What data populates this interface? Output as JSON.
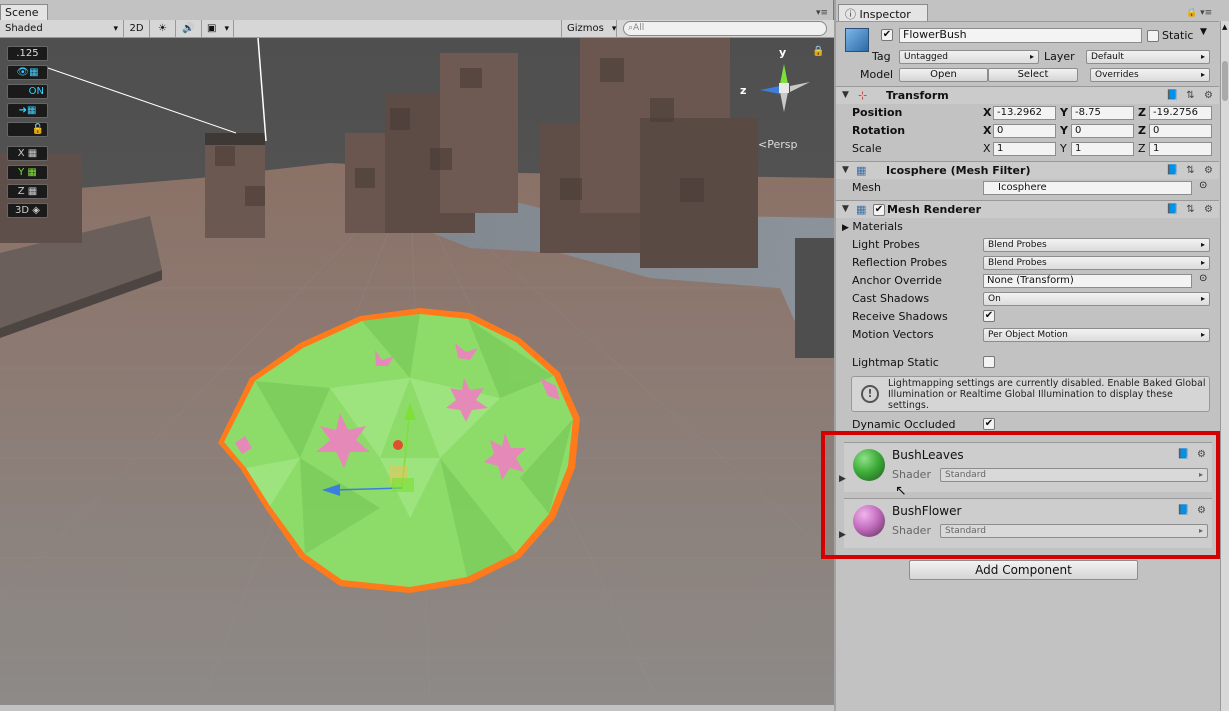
{
  "scene": {
    "tab_label": "Scene",
    "shading_mode": "Shaded",
    "btn_2d": "2D",
    "gizmos_label": "Gizmos",
    "search_placeholder": "All",
    "persp_label": "Persp",
    "gizmo_axes": {
      "y": "y",
      "z": "z"
    },
    "snap_widget": {
      "value": ".125",
      "on_label": "ON",
      "x": "X",
      "y": "Y",
      "z": "Z",
      "three_d": "3D"
    }
  },
  "inspector": {
    "tab_label": "Inspector",
    "object_name": "FlowerBush",
    "static_label": "Static",
    "tag_label": "Tag",
    "tag_value": "Untagged",
    "layer_label": "Layer",
    "layer_value": "Default",
    "model_label": "Model",
    "open_button": "Open",
    "select_button": "Select",
    "overrides_button": "Overrides",
    "transform": {
      "title": "Transform",
      "position_label": "Position",
      "rotation_label": "Rotation",
      "scale_label": "Scale",
      "axis_x": "X",
      "axis_y": "Y",
      "axis_z": "Z",
      "position": {
        "x": "-13.2962",
        "y": "-8.75",
        "z": "-19.2756"
      },
      "rotation": {
        "x": "0",
        "y": "0",
        "z": "0"
      },
      "scale": {
        "x": "1",
        "y": "1",
        "z": "1"
      }
    },
    "mesh_filter": {
      "title": "Icosphere (Mesh Filter)",
      "mesh_label": "Mesh",
      "mesh_value": "Icosphere"
    },
    "mesh_renderer": {
      "title": "Mesh Renderer",
      "materials_label": "Materials",
      "light_probes_label": "Light Probes",
      "light_probes_value": "Blend Probes",
      "reflection_probes_label": "Reflection Probes",
      "reflection_probes_value": "Blend Probes",
      "anchor_override_label": "Anchor Override",
      "anchor_override_value": "None (Transform)",
      "cast_shadows_label": "Cast Shadows",
      "cast_shadows_value": "On",
      "receive_shadows_label": "Receive Shadows",
      "motion_vectors_label": "Motion Vectors",
      "motion_vectors_value": "Per Object Motion",
      "lightmap_static_label": "Lightmap Static",
      "info_text": "Lightmapping settings are currently disabled. Enable Baked Global Illumination or Realtime Global Illumination to display these settings.",
      "dynamic_occluded_label": "Dynamic Occluded"
    },
    "materials": [
      {
        "name": "BushLeaves",
        "shader_label": "Shader",
        "shader_value": "Standard",
        "color": "#3fae3a"
      },
      {
        "name": "BushFlower",
        "shader_label": "Shader",
        "shader_value": "Standard",
        "color": "#c46fbf"
      }
    ],
    "add_component_button": "Add Component"
  },
  "colors": {
    "highlight": "#d40000",
    "bush": "#8ddc6a",
    "outline": "#ff7a1a",
    "flower": "#e58ab8"
  }
}
